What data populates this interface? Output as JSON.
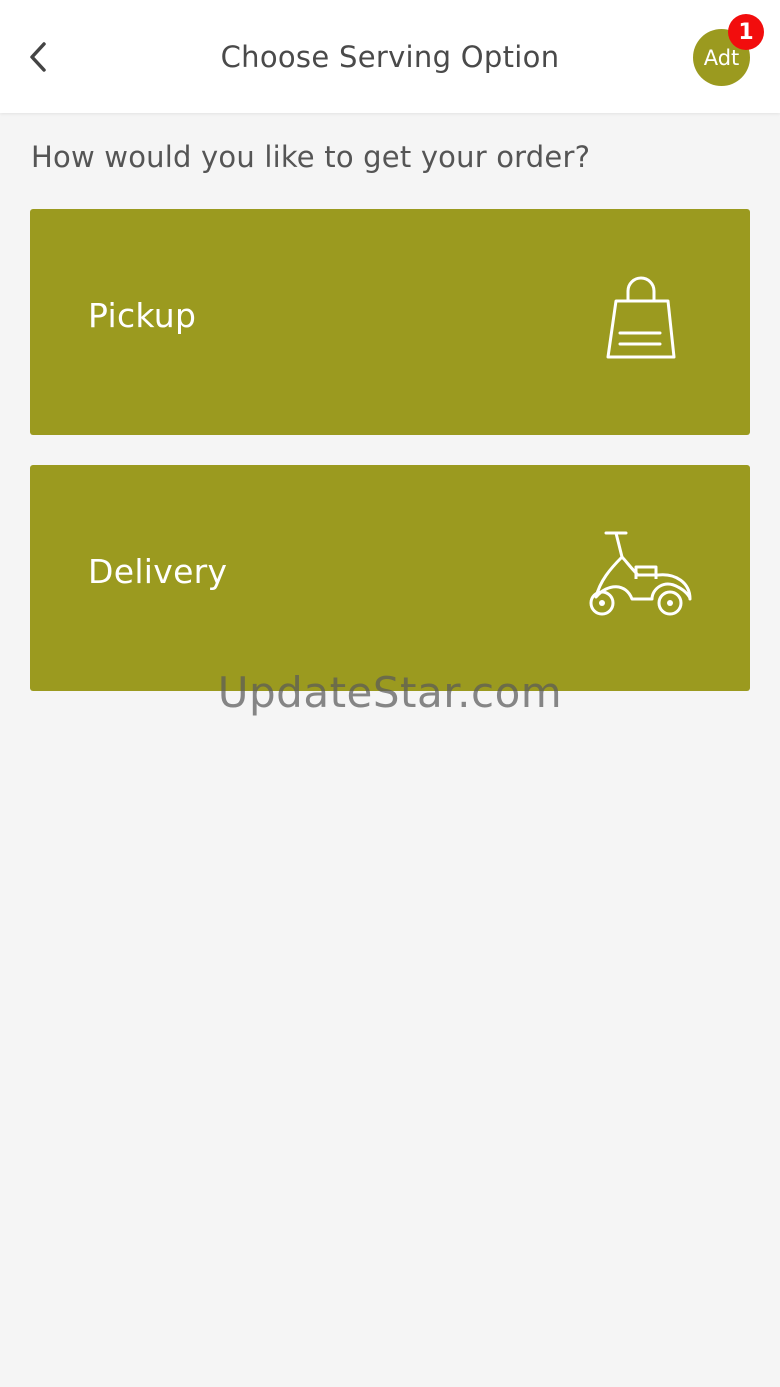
{
  "header": {
    "title": "Choose Serving Option",
    "avatar_initials": "Adt",
    "cart_badge_count": "1"
  },
  "main": {
    "prompt": "How would you like to get your order?",
    "options": [
      {
        "label": "Pickup",
        "icon": "shopping-bag-icon"
      },
      {
        "label": "Delivery",
        "icon": "scooter-icon"
      }
    ]
  },
  "watermark": "UpdateStar.com",
  "colors": {
    "accent": "#9b9a1f",
    "badge": "#f20d0d",
    "header_bg": "#ffffff",
    "page_bg": "#f5f5f5"
  }
}
